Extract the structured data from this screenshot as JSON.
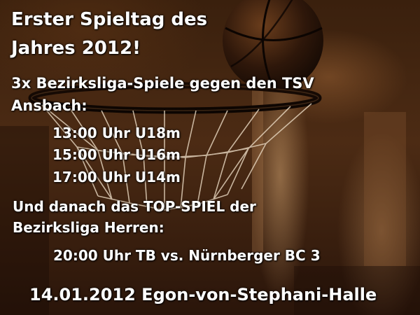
{
  "poster": {
    "title_line1": "Erster Spieltag des",
    "title_line2": "Jahres 2012!",
    "intro_line1": "3x Bezirksliga-Spiele gegen den TSV",
    "intro_line2": "Ansbach:",
    "games": [
      "13:00 Uhr U18m",
      "15:00 Uhr U16m",
      "17:00 Uhr U14m"
    ],
    "top_line1": "Und danach das TOP-SPIEL der",
    "top_line2": "Bezirksliga Herren:",
    "main_game": "20:00 Uhr  TB vs. Nürnberger BC 3",
    "footer": "14.01.2012 Egon-von-Stephani-Halle"
  },
  "colors": {
    "text": "#ffffff",
    "background_dark": "#2a150a",
    "background_warm": "#7a4a25"
  },
  "background_image": {
    "objects": [
      "basketball",
      "basketball-hoop",
      "net"
    ]
  }
}
